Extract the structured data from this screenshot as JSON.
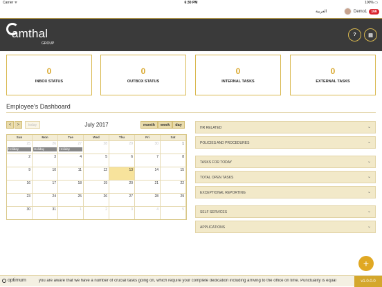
{
  "status_bar": {
    "carrier": "Carrier ᯤ",
    "time": "6:30 PM",
    "battery": "100% ▭"
  },
  "topbar": {
    "language": "العربية",
    "user_name": "Demo1",
    "notif_count": "166"
  },
  "header": {
    "logo_text": "amthal",
    "logo_sub": "GROUP",
    "help_label": "?",
    "doc_label": "▤"
  },
  "cards": [
    {
      "count": "0",
      "label": "INBOX STATUS"
    },
    {
      "count": "0",
      "label": "OUTBOX STATUS"
    },
    {
      "count": "0",
      "label": "INTERNAL TASKS"
    },
    {
      "count": "0",
      "label": "EXTERNAL TASKS"
    }
  ],
  "dashboard": {
    "title": "Employee's Dashboard"
  },
  "calendar": {
    "prev_label": "<",
    "next_label": ">",
    "today_label": "today",
    "title": "July 2017",
    "views": [
      "month",
      "week",
      "day"
    ],
    "weekdays": [
      "Sun",
      "Mon",
      "Tue",
      "Wed",
      "Thu",
      "Fri",
      "Sat"
    ],
    "weeks": [
      [
        "25",
        "26",
        "27",
        "28",
        "29",
        "30",
        "1"
      ],
      [
        "2",
        "3",
        "4",
        "5",
        "6",
        "7",
        "8"
      ],
      [
        "9",
        "10",
        "11",
        "12",
        "13",
        "14",
        "15"
      ],
      [
        "16",
        "17",
        "18",
        "19",
        "20",
        "21",
        "22"
      ],
      [
        "23",
        "24",
        "25",
        "26",
        "27",
        "28",
        "29"
      ],
      [
        "30",
        "31",
        "1",
        "2",
        "3",
        "4",
        "5"
      ]
    ],
    "holiday_label": "Holiday"
  },
  "accordions": [
    "HR RELATED",
    "POLICIES AND PROCEDURES",
    "TASKS FOR TODAY",
    "TOTAL OPEN TASKS",
    "EXCEPTIONAL REPORTING",
    "SELF SERVICES",
    "APPLICATIONS"
  ],
  "fab_label": "+",
  "footer": {
    "logo": "optimum",
    "ticker": "you are aware that we have a number of crucial tasks going on, which require your complete dedication including arriving to the office on time. Punctuality is equal",
    "version": "v1.0.0.0"
  }
}
